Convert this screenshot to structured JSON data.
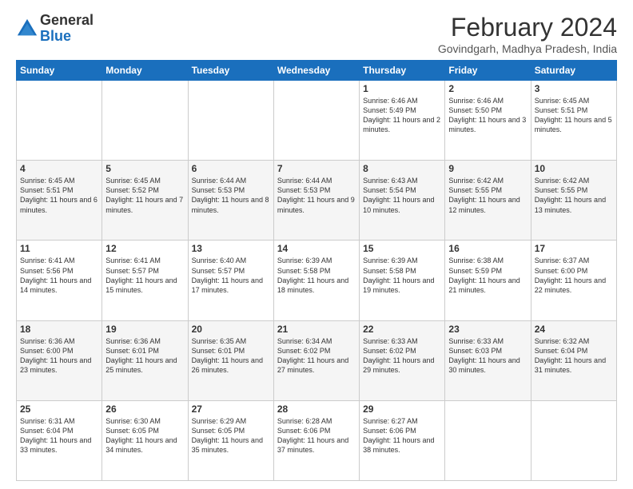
{
  "logo": {
    "general": "General",
    "blue": "Blue"
  },
  "header": {
    "month_year": "February 2024",
    "location": "Govindgarh, Madhya Pradesh, India"
  },
  "weekdays": [
    "Sunday",
    "Monday",
    "Tuesday",
    "Wednesday",
    "Thursday",
    "Friday",
    "Saturday"
  ],
  "weeks": [
    [
      {
        "day": "",
        "info": ""
      },
      {
        "day": "",
        "info": ""
      },
      {
        "day": "",
        "info": ""
      },
      {
        "day": "",
        "info": ""
      },
      {
        "day": "1",
        "info": "Sunrise: 6:46 AM\nSunset: 5:49 PM\nDaylight: 11 hours and 2 minutes."
      },
      {
        "day": "2",
        "info": "Sunrise: 6:46 AM\nSunset: 5:50 PM\nDaylight: 11 hours and 3 minutes."
      },
      {
        "day": "3",
        "info": "Sunrise: 6:45 AM\nSunset: 5:51 PM\nDaylight: 11 hours and 5 minutes."
      }
    ],
    [
      {
        "day": "4",
        "info": "Sunrise: 6:45 AM\nSunset: 5:51 PM\nDaylight: 11 hours and 6 minutes."
      },
      {
        "day": "5",
        "info": "Sunrise: 6:45 AM\nSunset: 5:52 PM\nDaylight: 11 hours and 7 minutes."
      },
      {
        "day": "6",
        "info": "Sunrise: 6:44 AM\nSunset: 5:53 PM\nDaylight: 11 hours and 8 minutes."
      },
      {
        "day": "7",
        "info": "Sunrise: 6:44 AM\nSunset: 5:53 PM\nDaylight: 11 hours and 9 minutes."
      },
      {
        "day": "8",
        "info": "Sunrise: 6:43 AM\nSunset: 5:54 PM\nDaylight: 11 hours and 10 minutes."
      },
      {
        "day": "9",
        "info": "Sunrise: 6:42 AM\nSunset: 5:55 PM\nDaylight: 11 hours and 12 minutes."
      },
      {
        "day": "10",
        "info": "Sunrise: 6:42 AM\nSunset: 5:55 PM\nDaylight: 11 hours and 13 minutes."
      }
    ],
    [
      {
        "day": "11",
        "info": "Sunrise: 6:41 AM\nSunset: 5:56 PM\nDaylight: 11 hours and 14 minutes."
      },
      {
        "day": "12",
        "info": "Sunrise: 6:41 AM\nSunset: 5:57 PM\nDaylight: 11 hours and 15 minutes."
      },
      {
        "day": "13",
        "info": "Sunrise: 6:40 AM\nSunset: 5:57 PM\nDaylight: 11 hours and 17 minutes."
      },
      {
        "day": "14",
        "info": "Sunrise: 6:39 AM\nSunset: 5:58 PM\nDaylight: 11 hours and 18 minutes."
      },
      {
        "day": "15",
        "info": "Sunrise: 6:39 AM\nSunset: 5:58 PM\nDaylight: 11 hours and 19 minutes."
      },
      {
        "day": "16",
        "info": "Sunrise: 6:38 AM\nSunset: 5:59 PM\nDaylight: 11 hours and 21 minutes."
      },
      {
        "day": "17",
        "info": "Sunrise: 6:37 AM\nSunset: 6:00 PM\nDaylight: 11 hours and 22 minutes."
      }
    ],
    [
      {
        "day": "18",
        "info": "Sunrise: 6:36 AM\nSunset: 6:00 PM\nDaylight: 11 hours and 23 minutes."
      },
      {
        "day": "19",
        "info": "Sunrise: 6:36 AM\nSunset: 6:01 PM\nDaylight: 11 hours and 25 minutes."
      },
      {
        "day": "20",
        "info": "Sunrise: 6:35 AM\nSunset: 6:01 PM\nDaylight: 11 hours and 26 minutes."
      },
      {
        "day": "21",
        "info": "Sunrise: 6:34 AM\nSunset: 6:02 PM\nDaylight: 11 hours and 27 minutes."
      },
      {
        "day": "22",
        "info": "Sunrise: 6:33 AM\nSunset: 6:02 PM\nDaylight: 11 hours and 29 minutes."
      },
      {
        "day": "23",
        "info": "Sunrise: 6:33 AM\nSunset: 6:03 PM\nDaylight: 11 hours and 30 minutes."
      },
      {
        "day": "24",
        "info": "Sunrise: 6:32 AM\nSunset: 6:04 PM\nDaylight: 11 hours and 31 minutes."
      }
    ],
    [
      {
        "day": "25",
        "info": "Sunrise: 6:31 AM\nSunset: 6:04 PM\nDaylight: 11 hours and 33 minutes."
      },
      {
        "day": "26",
        "info": "Sunrise: 6:30 AM\nSunset: 6:05 PM\nDaylight: 11 hours and 34 minutes."
      },
      {
        "day": "27",
        "info": "Sunrise: 6:29 AM\nSunset: 6:05 PM\nDaylight: 11 hours and 35 minutes."
      },
      {
        "day": "28",
        "info": "Sunrise: 6:28 AM\nSunset: 6:06 PM\nDaylight: 11 hours and 37 minutes."
      },
      {
        "day": "29",
        "info": "Sunrise: 6:27 AM\nSunset: 6:06 PM\nDaylight: 11 hours and 38 minutes."
      },
      {
        "day": "",
        "info": ""
      },
      {
        "day": "",
        "info": ""
      }
    ]
  ]
}
